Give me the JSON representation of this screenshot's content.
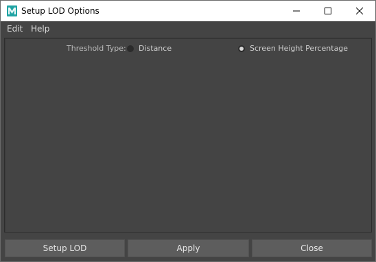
{
  "window": {
    "title": "Setup LOD Options",
    "icon": "maya-logo-icon"
  },
  "menubar": {
    "items": [
      {
        "label": "Edit"
      },
      {
        "label": "Help"
      }
    ]
  },
  "panel": {
    "threshold_label": "Threshold Type:",
    "options": [
      {
        "label": "Distance",
        "selected": false
      },
      {
        "label": "Screen Height Percentage",
        "selected": true
      }
    ]
  },
  "buttons": {
    "setup_lod": "Setup LOD",
    "apply": "Apply",
    "close": "Close"
  },
  "colors": {
    "window_bg": "#444444",
    "button_bg": "#5d5d5d",
    "titlebar_bg": "#ffffff",
    "icon_accent": "#1fa3a3"
  }
}
